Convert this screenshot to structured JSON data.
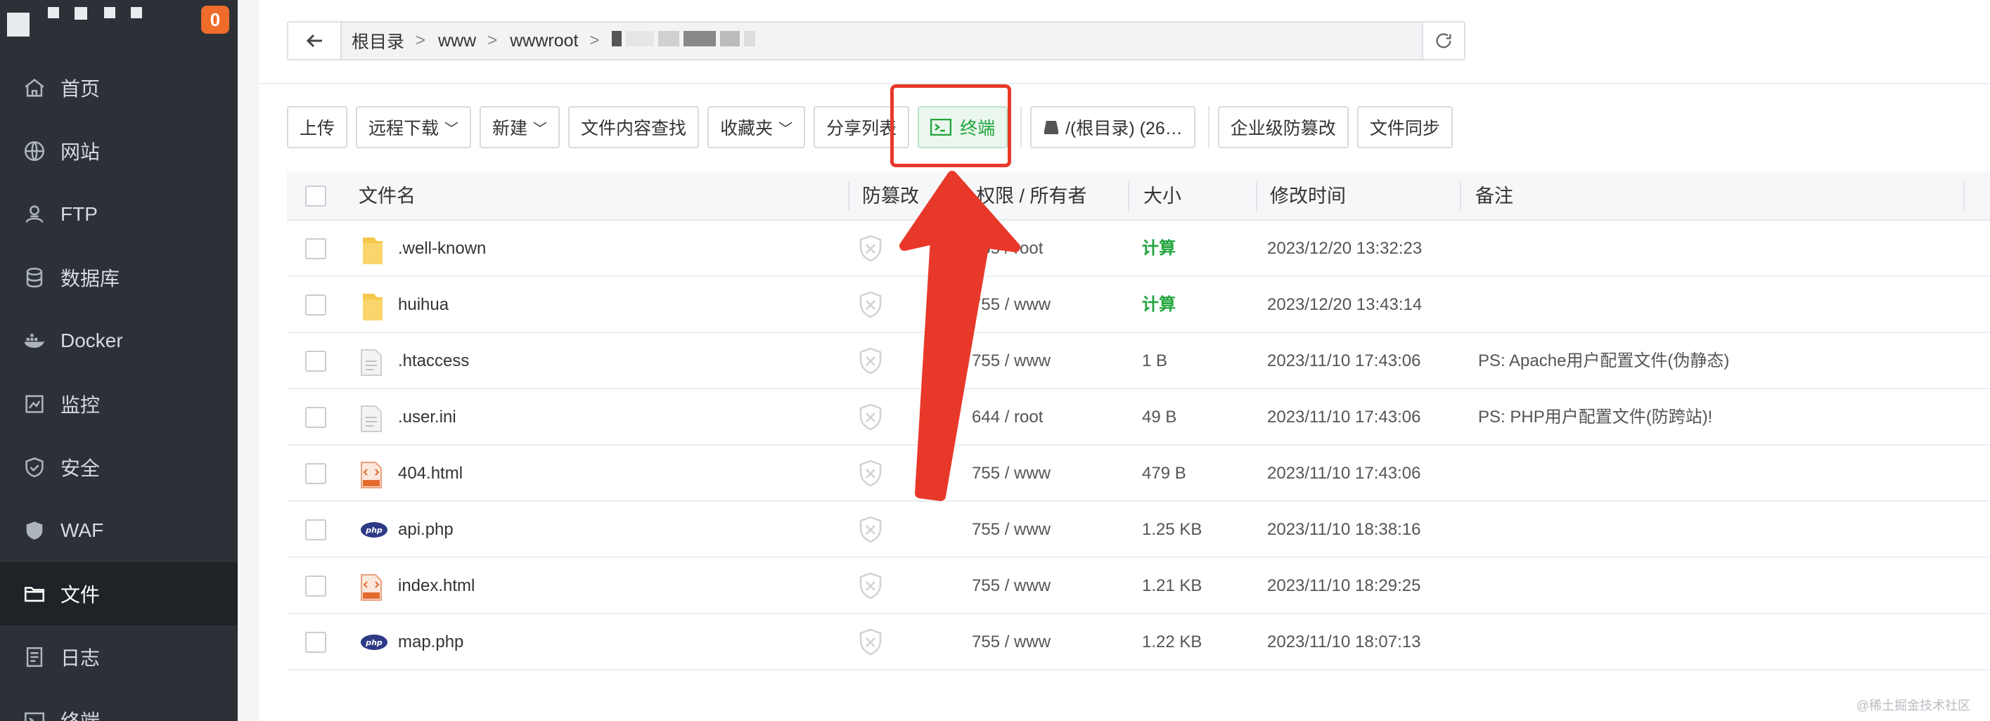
{
  "sidebar": {
    "notification_count": "0",
    "items": [
      {
        "label": "首页",
        "icon": "home-icon"
      },
      {
        "label": "网站",
        "icon": "globe-icon"
      },
      {
        "label": "FTP",
        "icon": "ftp-icon"
      },
      {
        "label": "数据库",
        "icon": "database-icon"
      },
      {
        "label": "Docker",
        "icon": "docker-icon"
      },
      {
        "label": "监控",
        "icon": "monitor-icon"
      },
      {
        "label": "安全",
        "icon": "shield-check-icon"
      },
      {
        "label": "WAF",
        "icon": "waf-shield-icon"
      },
      {
        "label": "文件",
        "icon": "folder-icon",
        "active": true
      },
      {
        "label": "日志",
        "icon": "log-icon"
      },
      {
        "label": "终端",
        "icon": "terminal-icon"
      }
    ]
  },
  "path": {
    "crumbs": [
      "根目录",
      "www",
      "wwwroot"
    ],
    "separator": ">"
  },
  "toolbar": {
    "upload": "上传",
    "remote_download": "远程下载",
    "new": "新建",
    "search_content": "文件内容查找",
    "favorites": "收藏夹",
    "share_list": "分享列表",
    "terminal": "终端",
    "disk": "/(根目录) (26…",
    "tamper_proof": "企业级防篡改",
    "file_sync": "文件同步"
  },
  "table": {
    "headers": {
      "name": "文件名",
      "tamper": "防篡改",
      "perm": "权限 / 所有者",
      "size": "大小",
      "mtime": "修改时间",
      "note": "备注"
    },
    "rows": [
      {
        "name": ".well-known",
        "type": "folder",
        "perm": "755 / root",
        "size": "计算",
        "mtime": "2023/12/20 13:32:23",
        "note": ""
      },
      {
        "name": "huihua",
        "type": "folder",
        "perm": "755 / www",
        "size": "计算",
        "mtime": "2023/12/20 13:43:14",
        "note": ""
      },
      {
        "name": ".htaccess",
        "type": "text",
        "perm": "755 / www",
        "size": "1 B",
        "mtime": "2023/11/10 17:43:06",
        "note": "PS: Apache用户配置文件(伪静态)"
      },
      {
        "name": ".user.ini",
        "type": "text",
        "perm": "644 / root",
        "size": "49 B",
        "mtime": "2023/11/10 17:43:06",
        "note": "PS: PHP用户配置文件(防跨站)!"
      },
      {
        "name": "404.html",
        "type": "html",
        "perm": "755 / www",
        "size": "479 B",
        "mtime": "2023/11/10 17:43:06",
        "note": ""
      },
      {
        "name": "api.php",
        "type": "php",
        "perm": "755 / www",
        "size": "1.25 KB",
        "mtime": "2023/11/10 18:38:16",
        "note": ""
      },
      {
        "name": "index.html",
        "type": "html",
        "perm": "755 / www",
        "size": "1.21 KB",
        "mtime": "2023/11/10 18:29:25",
        "note": ""
      },
      {
        "name": "map.php",
        "type": "php",
        "perm": "755 / www",
        "size": "1.22 KB",
        "mtime": "2023/11/10 18:07:13",
        "note": ""
      }
    ]
  },
  "watermark": "@稀土掘金技术社区",
  "colors": {
    "accent_green": "#20a53a",
    "highlight_red": "#e8382a",
    "sidebar_bg": "#2c3138"
  }
}
